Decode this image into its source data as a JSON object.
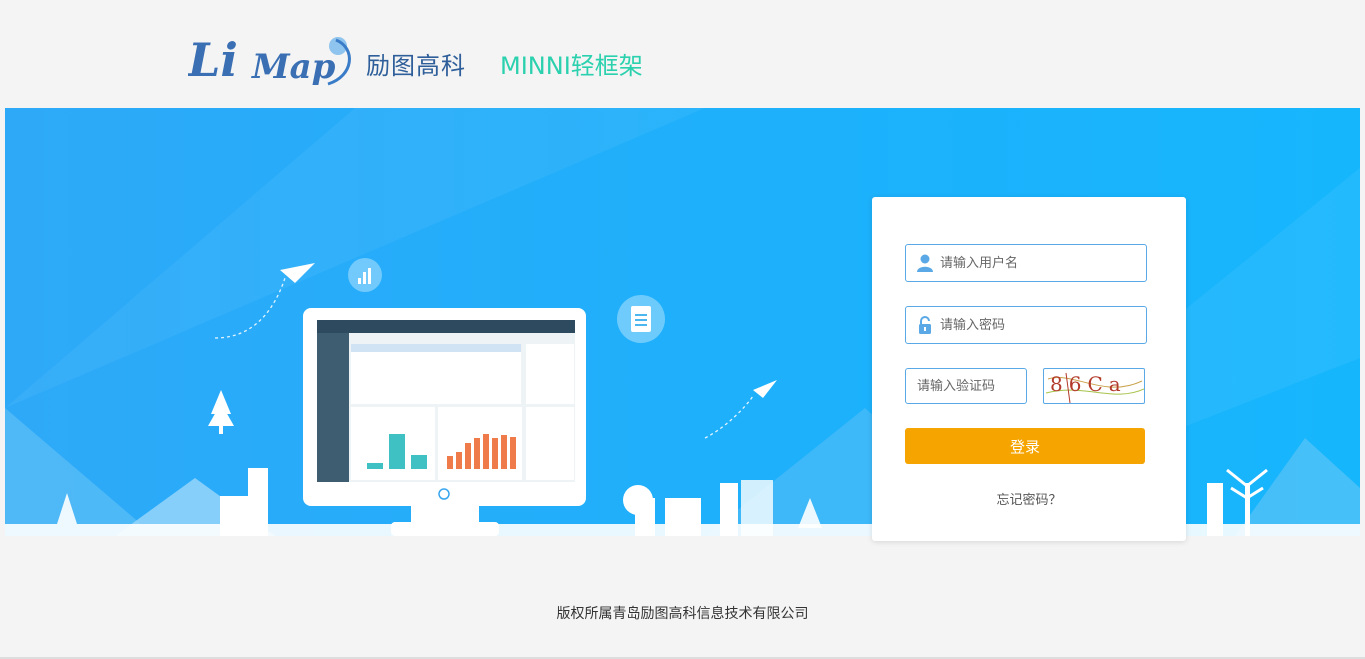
{
  "header": {
    "logo_text": "LiMap",
    "company_name": "励图高科",
    "product_name": "MINNI轻框架"
  },
  "login": {
    "username_placeholder": "请输入用户名",
    "password_placeholder": "请输入密码",
    "captcha_placeholder": "请输入验证码",
    "captcha_text": "86Ca",
    "login_label": "登录",
    "forgot_label": "忘记密码？"
  },
  "footer": {
    "copyright": "版权所属青岛励图高科信息技术有限公司"
  },
  "colors": {
    "accent": "#f5a400",
    "banner": "#1eb0fb",
    "input_border": "#5aa9e6",
    "product": "#2bd1ae"
  }
}
